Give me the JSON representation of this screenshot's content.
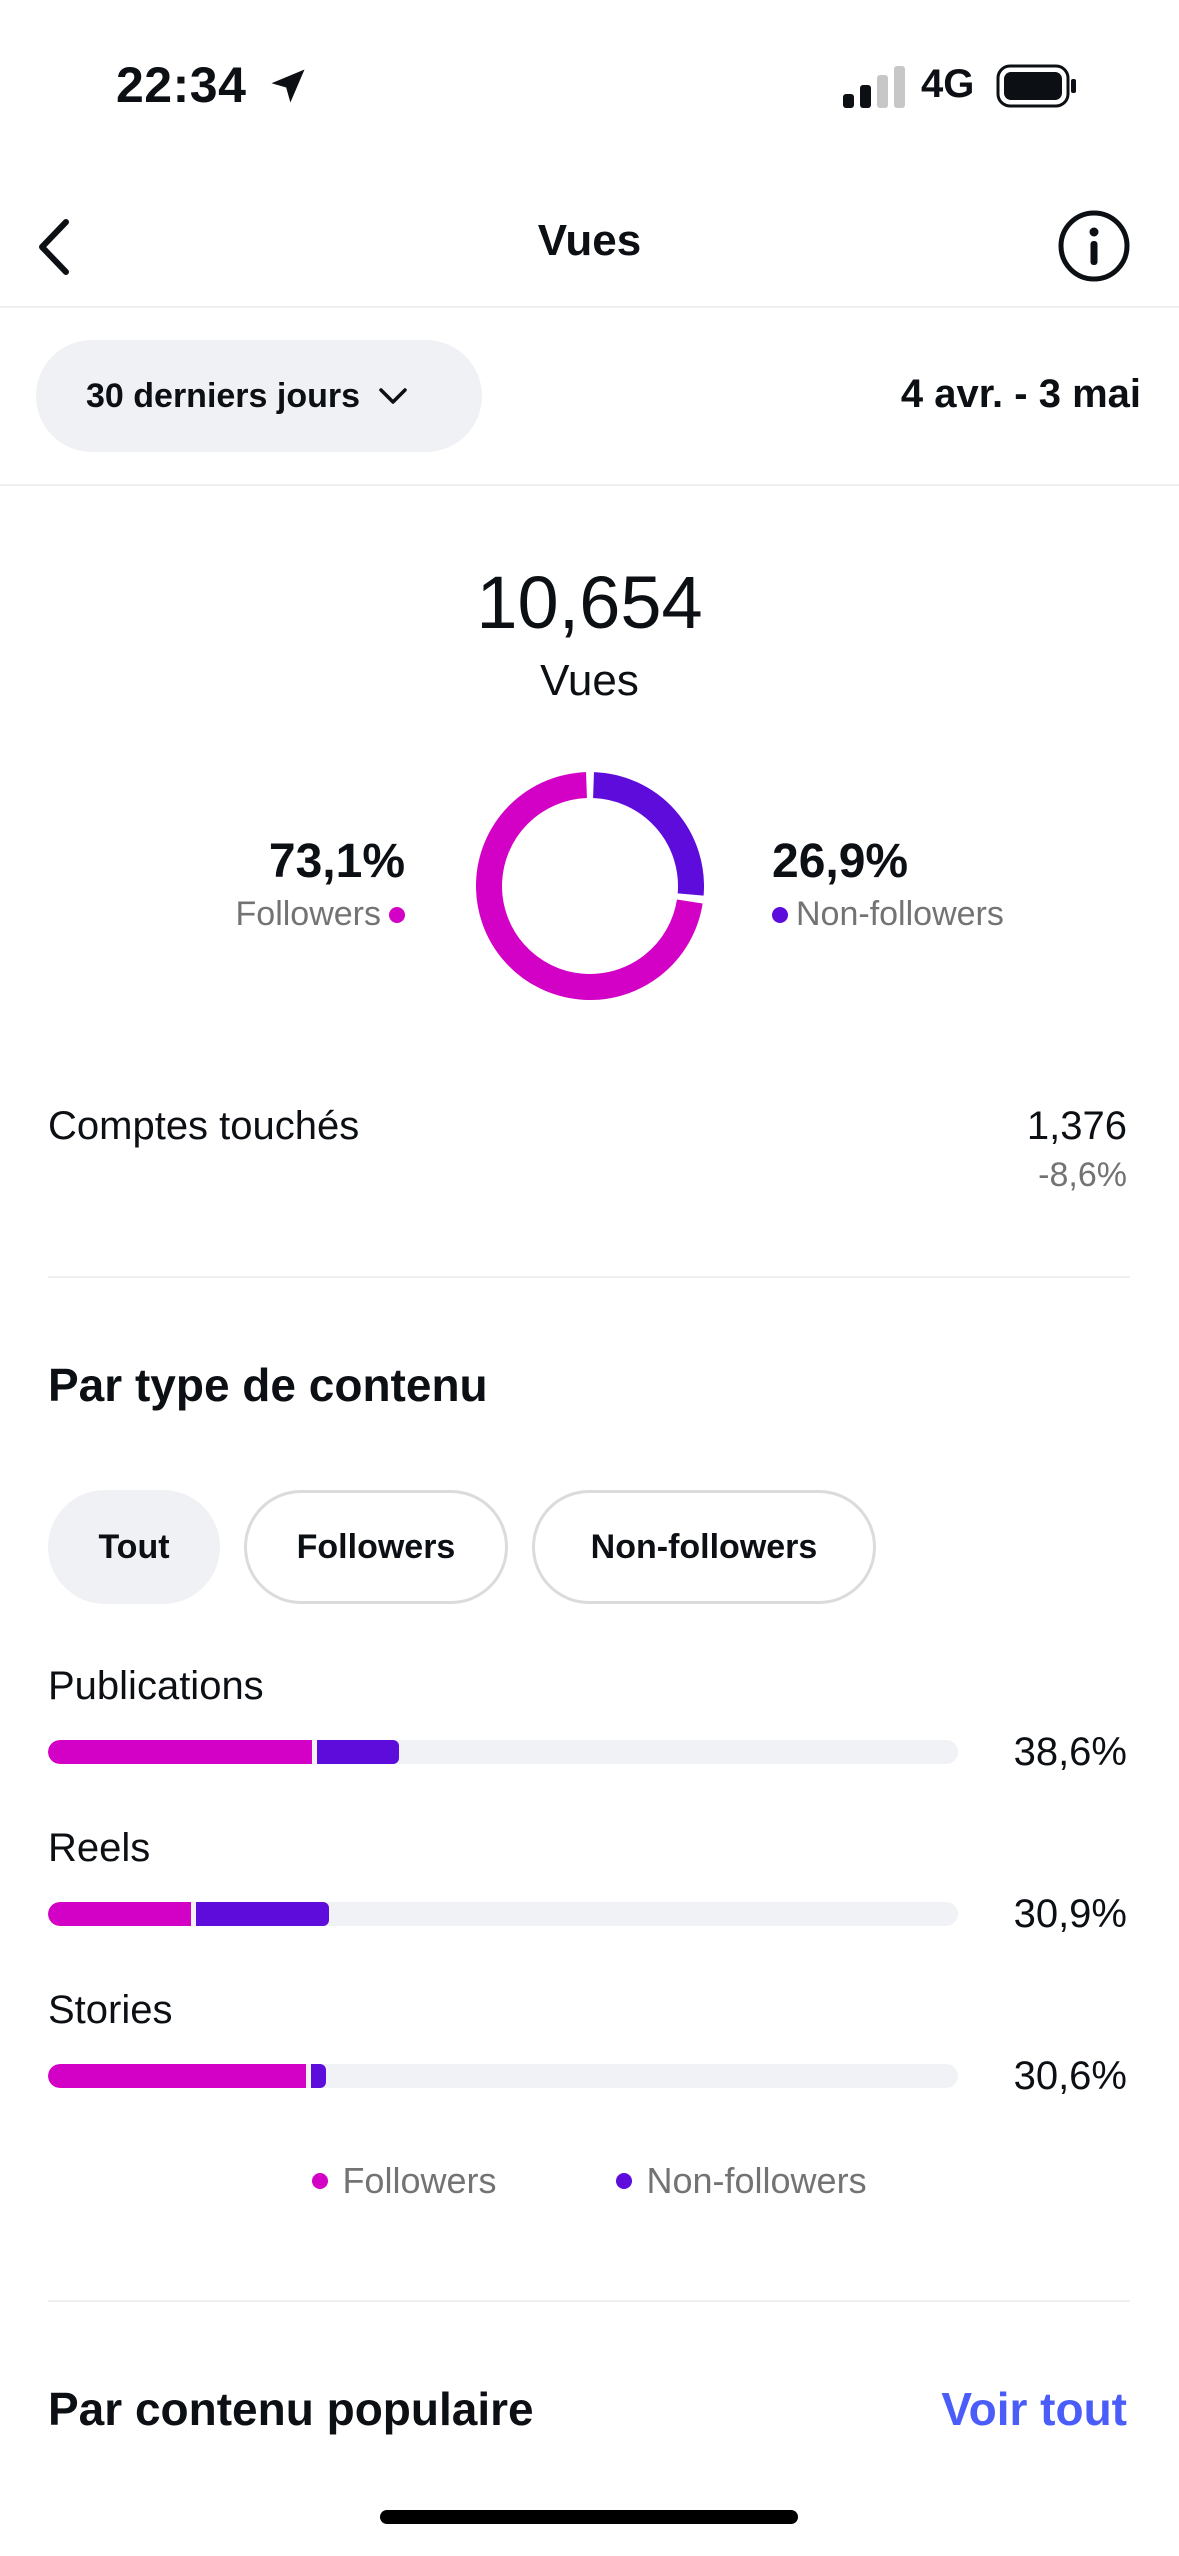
{
  "status_bar": {
    "time": "22:34",
    "network": "4G"
  },
  "header": {
    "title": "Vues"
  },
  "filter": {
    "range_label": "30 derniers jours",
    "date_range": "4 avr. - 3 mai"
  },
  "summary": {
    "total": "10,654",
    "total_label": "Vues",
    "followers_pct": "73,1%",
    "followers_label": "Followers",
    "non_followers_pct": "26,9%",
    "non_followers_label": "Non-followers",
    "followers_fraction": 0.731,
    "non_followers_fraction": 0.269
  },
  "accounts": {
    "label": "Comptes touchés",
    "value": "1,376",
    "change": "-8,6%"
  },
  "content_type": {
    "title": "Par type de contenu",
    "tabs": [
      {
        "label": "Tout",
        "active": true
      },
      {
        "label": "Followers",
        "active": false
      },
      {
        "label": "Non-followers",
        "active": false
      }
    ],
    "bars": [
      {
        "label": "Publications",
        "pct_text": "38,6%",
        "followers_pct": 29.0,
        "non_followers_pct": 9.6
      },
      {
        "label": "Reels",
        "pct_text": "30,9%",
        "followers_pct": 15.7,
        "non_followers_pct": 15.2
      },
      {
        "label": "Stories",
        "pct_text": "30,6%",
        "followers_pct": 28.3,
        "non_followers_pct": 2.3
      }
    ],
    "legend": {
      "followers": "Followers",
      "non_followers": "Non-followers"
    }
  },
  "popular": {
    "title": "Par contenu populaire",
    "see_all": "Voir tout"
  },
  "colors": {
    "followers": "#d300c5",
    "non_followers": "#5e0cdc",
    "link": "#4a5df9",
    "muted": "#737373"
  }
}
